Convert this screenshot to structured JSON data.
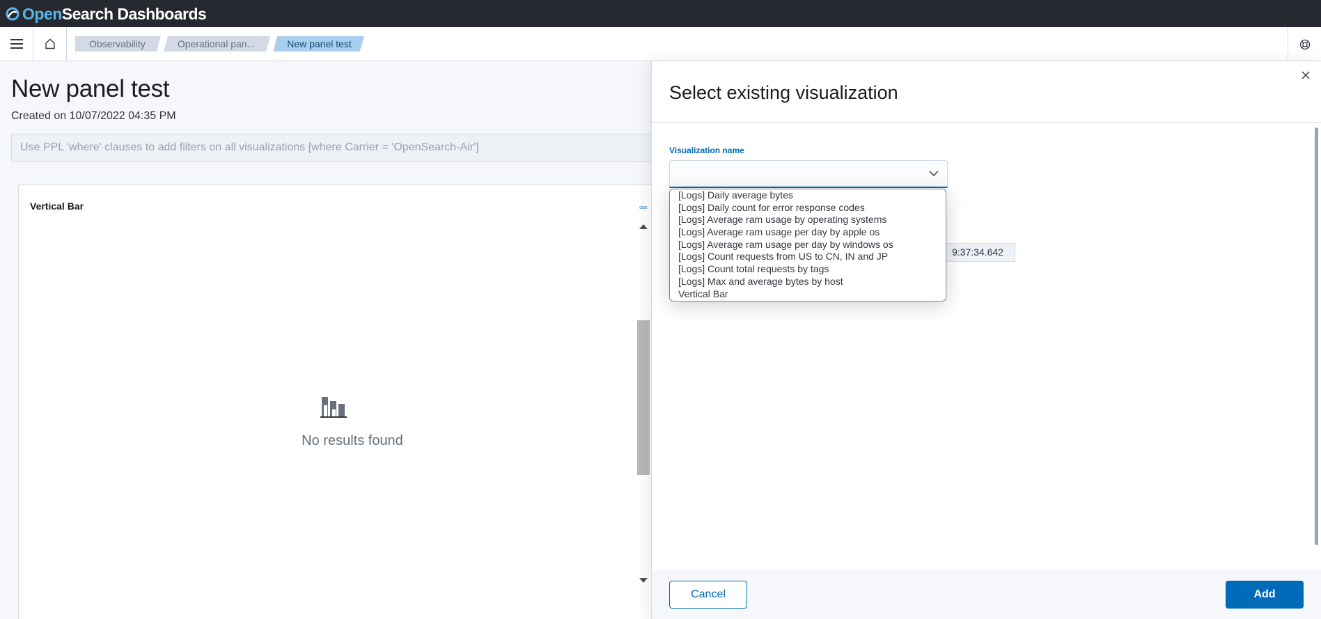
{
  "header": {
    "logo_open": "Open",
    "logo_rest": "Search Dashboards",
    "icons": [
      "menu-icon",
      "home-icon",
      "help-icon"
    ]
  },
  "breadcrumbs": [
    "Observability",
    "Operational pan...",
    "New panel test"
  ],
  "page": {
    "title": "New panel test",
    "created": "Created on 10/07/2022 04:35 PM",
    "filter_placeholder": "Use PPL 'where' clauses to add filters on all visualizations [where Carrier = 'OpenSearch-Air']"
  },
  "panel": {
    "title": "Vertical Bar",
    "empty_text": "No results found",
    "empty_icon": "bar-chart-icon"
  },
  "flyout": {
    "title": "Select existing visualization",
    "field_label": "Visualization name",
    "selected_value": "",
    "hidden_date": "9:37:34.642",
    "options": [
      "[Logs] Daily average bytes",
      "[Logs] Daily count for error response codes",
      "[Logs] Average ram usage by operating systems",
      "[Logs] Average ram usage per day by apple os",
      "[Logs] Average ram usage per day by windows os",
      "[Logs] Count requests from US to CN, IN and JP",
      "[Logs] Count total requests by tags",
      "[Logs] Max and average bytes by host",
      "Vertical Bar"
    ],
    "cancel_label": "Cancel",
    "add_label": "Add"
  },
  "colors": {
    "accent": "#006bb8",
    "header_bg": "#25282f",
    "breadcrumb_active": "#a8cfed"
  }
}
